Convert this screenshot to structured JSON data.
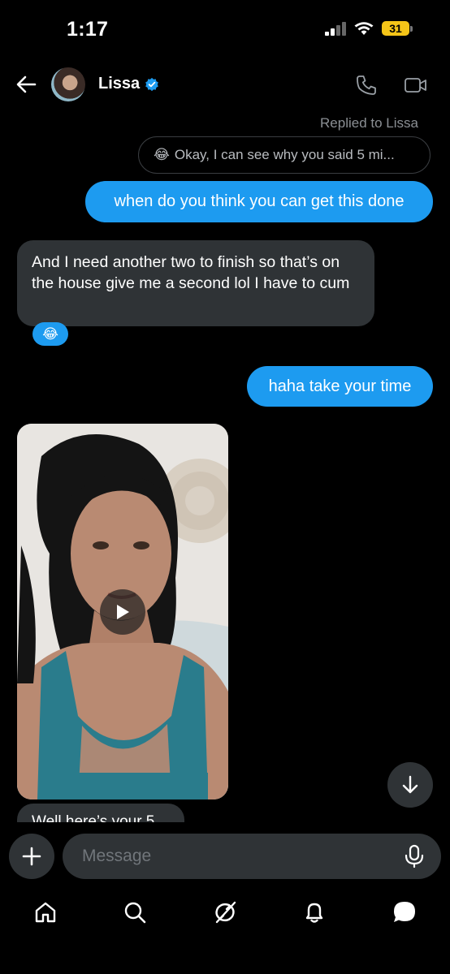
{
  "status_bar": {
    "time": "1:17",
    "battery": "31"
  },
  "header": {
    "contact_name": "Lissa",
    "verified": true
  },
  "messages": {
    "replied_label": "Replied to Lissa",
    "reply_quote": "Okay, I can see why you said 5 mi...",
    "reply_quote_emoji": "😂",
    "outgoing_1": "when do you think you can get this done",
    "incoming_1": "And I need another two to finish so that’s on the house give me a second lol I have to cum",
    "reaction_emoji": "😂",
    "outgoing_2": "haha take your time",
    "partial_incoming": "Well here’s your 5"
  },
  "composer": {
    "placeholder": "Message"
  },
  "colors": {
    "accent": "#1d9bf0",
    "bubble_in": "#2f3336",
    "background": "#000000"
  },
  "tabs": [
    "home-icon",
    "search-icon",
    "grok-icon",
    "notifications-icon",
    "messages-icon"
  ]
}
